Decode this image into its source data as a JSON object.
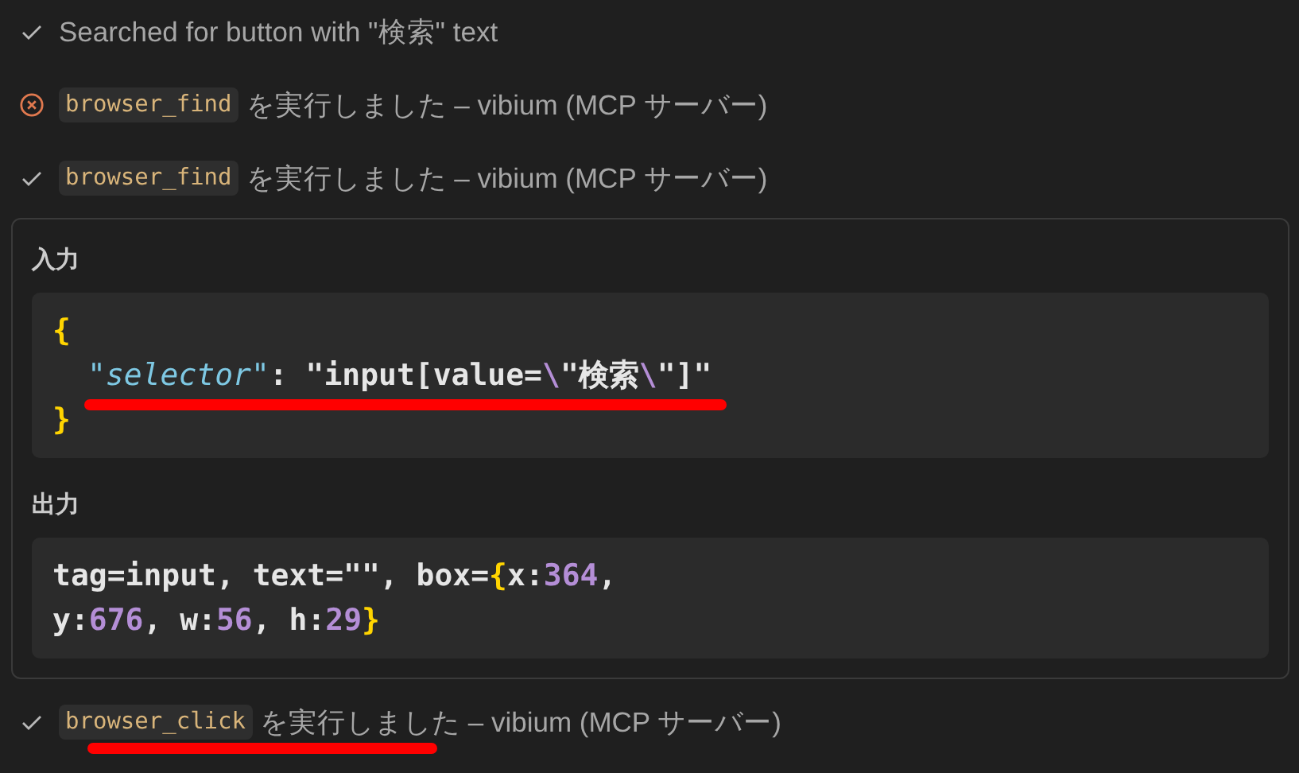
{
  "steps_before": [
    {
      "failed": false,
      "kind": "text",
      "text": "Searched for button with \"検索\" text",
      "underlined": false
    },
    {
      "failed": true,
      "kind": "tool",
      "tool": "browser_find",
      "text": "を実行しました – vibium (MCP サーバー)",
      "underlined": false
    },
    {
      "failed": false,
      "kind": "tool",
      "tool": "browser_find",
      "text": "を実行しました – vibium (MCP サーバー)",
      "underlined": false
    }
  ],
  "details": {
    "sections": [
      {
        "heading": "入力",
        "lines": [
          {
            "underlined": false,
            "tokens": [
              {
                "kind": "brace",
                "text": "{"
              }
            ]
          },
          {
            "underlined": true,
            "tokens": [
              {
                "kind": "key",
                "text": "\"selector\""
              },
              {
                "kind": "plain",
                "text": ": \"input[value="
              },
              {
                "kind": "escape",
                "text": "\\"
              },
              {
                "kind": "plain",
                "text": "\"検索"
              },
              {
                "kind": "escape",
                "text": "\\"
              },
              {
                "kind": "plain",
                "text": "\"]\""
              }
            ]
          },
          {
            "underlined": false,
            "tokens": [
              {
                "kind": "brace",
                "text": "}"
              }
            ]
          }
        ]
      },
      {
        "heading": "出力",
        "lines": [
          {
            "underlined": false,
            "tokens": [
              {
                "kind": "plain",
                "text": "tag=input, text=\"\", box="
              },
              {
                "kind": "brace",
                "text": "{"
              },
              {
                "kind": "plain",
                "text": "x:"
              },
              {
                "kind": "number",
                "text": "364"
              },
              {
                "kind": "plain",
                "text": ","
              }
            ]
          },
          {
            "underlined": false,
            "tokens": [
              {
                "kind": "plain",
                "text": "y:"
              },
              {
                "kind": "number",
                "text": "676"
              },
              {
                "kind": "plain",
                "text": ", w:"
              },
              {
                "kind": "number",
                "text": "56"
              },
              {
                "kind": "plain",
                "text": ", h:"
              },
              {
                "kind": "number",
                "text": "29"
              },
              {
                "kind": "brace",
                "text": "}"
              }
            ]
          }
        ]
      }
    ]
  },
  "steps_after": [
    {
      "failed": false,
      "kind": "tool",
      "tool": "browser_click",
      "text": "を実行しました – vibium (MCP サーバー)",
      "underlined": true
    }
  ]
}
